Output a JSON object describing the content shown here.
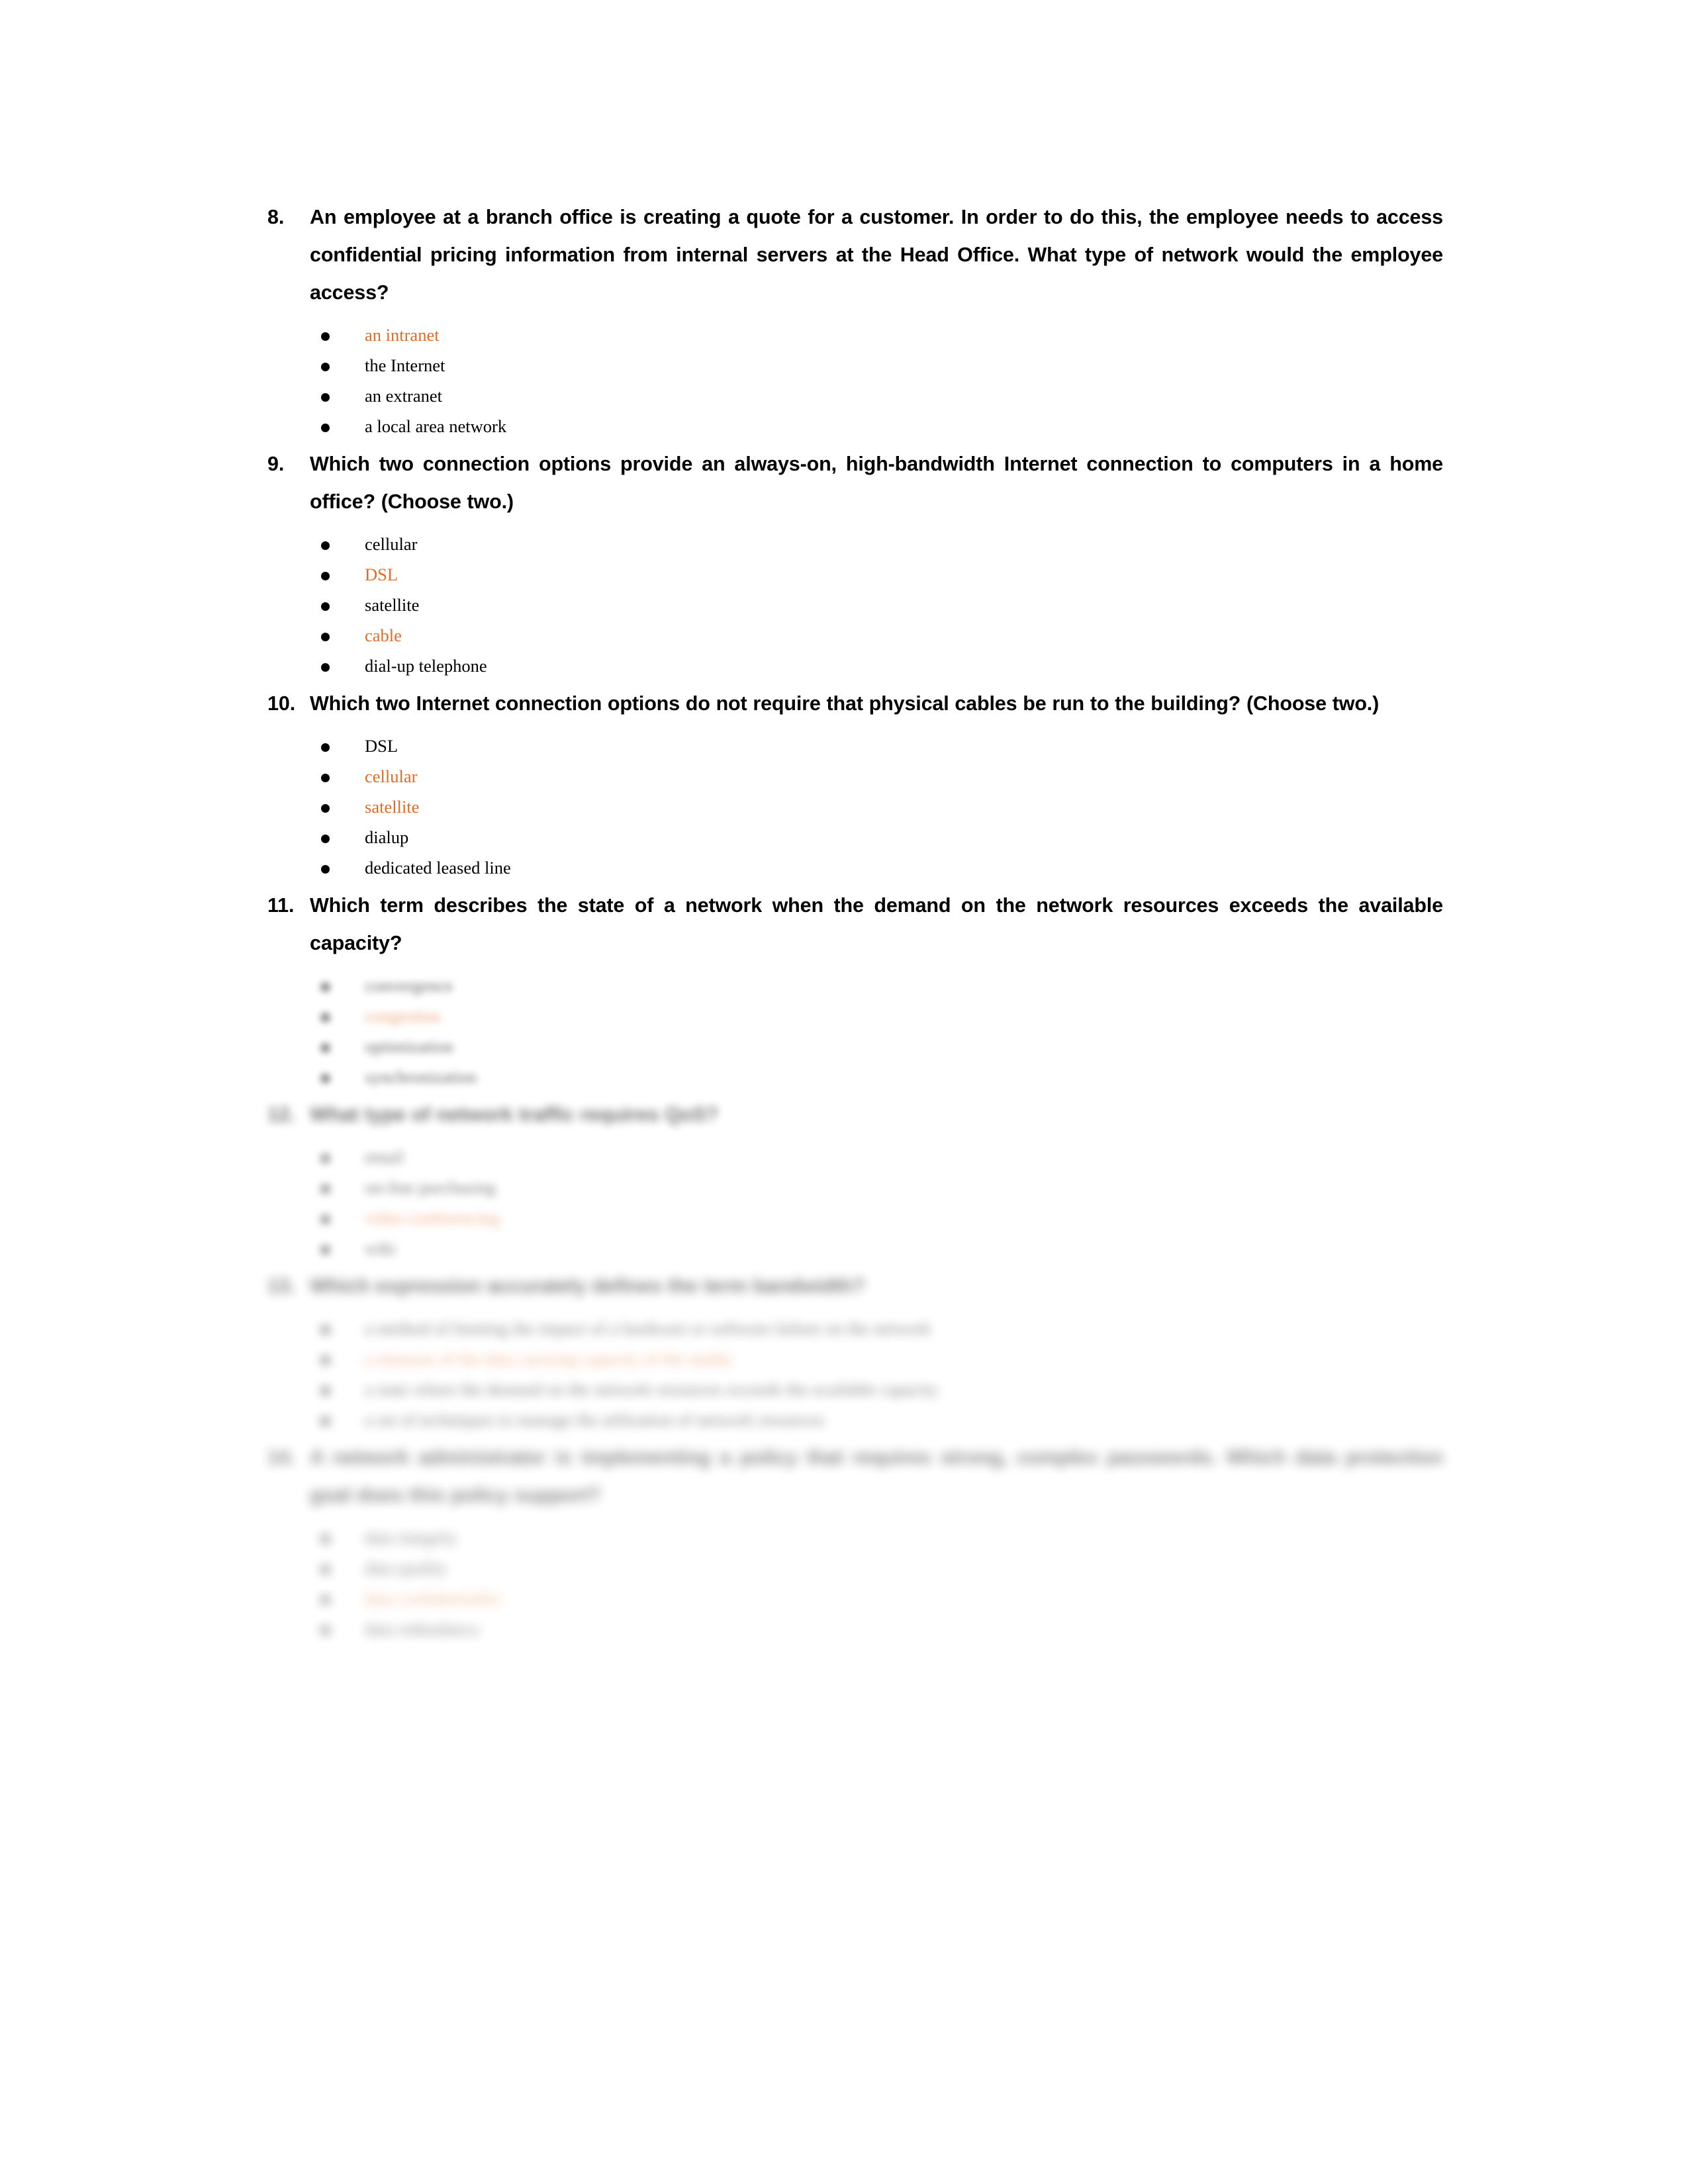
{
  "document": {
    "type": "networking-quiz-answer-key",
    "accent_color": "#E36B24",
    "text_color": "#000000",
    "background_color": "#FFFFFF",
    "bullet_glyph": "•"
  },
  "questions": [
    {
      "number": "8.",
      "text": "An employee at a branch office is creating a quote for a customer. In order to do this, the employee needs to access confidential pricing information from internal servers at the Head Office. What type of network would the employee access?",
      "blurred": false,
      "options": [
        {
          "label": "an intranet",
          "correct": true
        },
        {
          "label": "the Internet",
          "correct": false
        },
        {
          "label": "an extranet",
          "correct": false
        },
        {
          "label": "a local area network",
          "correct": false
        }
      ]
    },
    {
      "number": "9.",
      "text": "Which two connection options provide an always-on, high-bandwidth Internet connection to computers in a home office? (Choose two.)",
      "blurred": false,
      "options": [
        {
          "label": "cellular",
          "correct": false
        },
        {
          "label": "DSL",
          "correct": true
        },
        {
          "label": "satellite",
          "correct": false
        },
        {
          "label": "cable",
          "correct": true
        },
        {
          "label": "dial-up telephone",
          "correct": false
        }
      ]
    },
    {
      "number": "10.",
      "text": "Which two Internet connection options do not require that physical cables be run to the building? (Choose two.)",
      "blurred": false,
      "options": [
        {
          "label": "DSL",
          "correct": false
        },
        {
          "label": "cellular",
          "correct": true
        },
        {
          "label": "satellite",
          "correct": true
        },
        {
          "label": "dialup",
          "correct": false
        },
        {
          "label": "dedicated leased line",
          "correct": false
        }
      ]
    },
    {
      "number": "11.",
      "text": "Which term describes the state of a network when the demand on the network resources exceeds the available capacity?",
      "blurred": false,
      "blurred_options": true,
      "blur_level": 1,
      "options": [
        {
          "label": "convergence",
          "correct": false
        },
        {
          "label": "congestion",
          "correct": true
        },
        {
          "label": "optimization",
          "correct": false
        },
        {
          "label": "synchronization",
          "correct": false
        }
      ]
    },
    {
      "number": "12.",
      "text": "What type of network traffic requires QoS?",
      "blurred": true,
      "blur_level": 2,
      "options": [
        {
          "label": "email",
          "correct": false
        },
        {
          "label": "on-line purchasing",
          "correct": false
        },
        {
          "label": "video conferencing",
          "correct": true
        },
        {
          "label": "wiki",
          "correct": false
        }
      ]
    },
    {
      "number": "13.",
      "text": "Which expression accurately defines the term bandwidth?",
      "blurred": true,
      "blur_level": 3,
      "options": [
        {
          "label": "a method of limiting the impact of a hardware or software failure on the network",
          "correct": false
        },
        {
          "label": "a measure of the data carrying capacity of the media",
          "correct": true
        },
        {
          "label": "a state where the demand on the network resources exceeds the available capacity",
          "correct": false
        },
        {
          "label": "a set of techniques to manage the utilization of network resources",
          "correct": false
        }
      ]
    },
    {
      "number": "14.",
      "text": "A network administrator is implementing a policy that requires strong, complex passwords. Which data protection goal does this policy support?",
      "blurred": true,
      "blur_level": 4,
      "options": [
        {
          "label": "data integrity",
          "correct": false
        },
        {
          "label": "data quality",
          "correct": false
        },
        {
          "label": "data confidentiality",
          "correct": true
        },
        {
          "label": "data redundancy",
          "correct": false
        }
      ]
    }
  ]
}
